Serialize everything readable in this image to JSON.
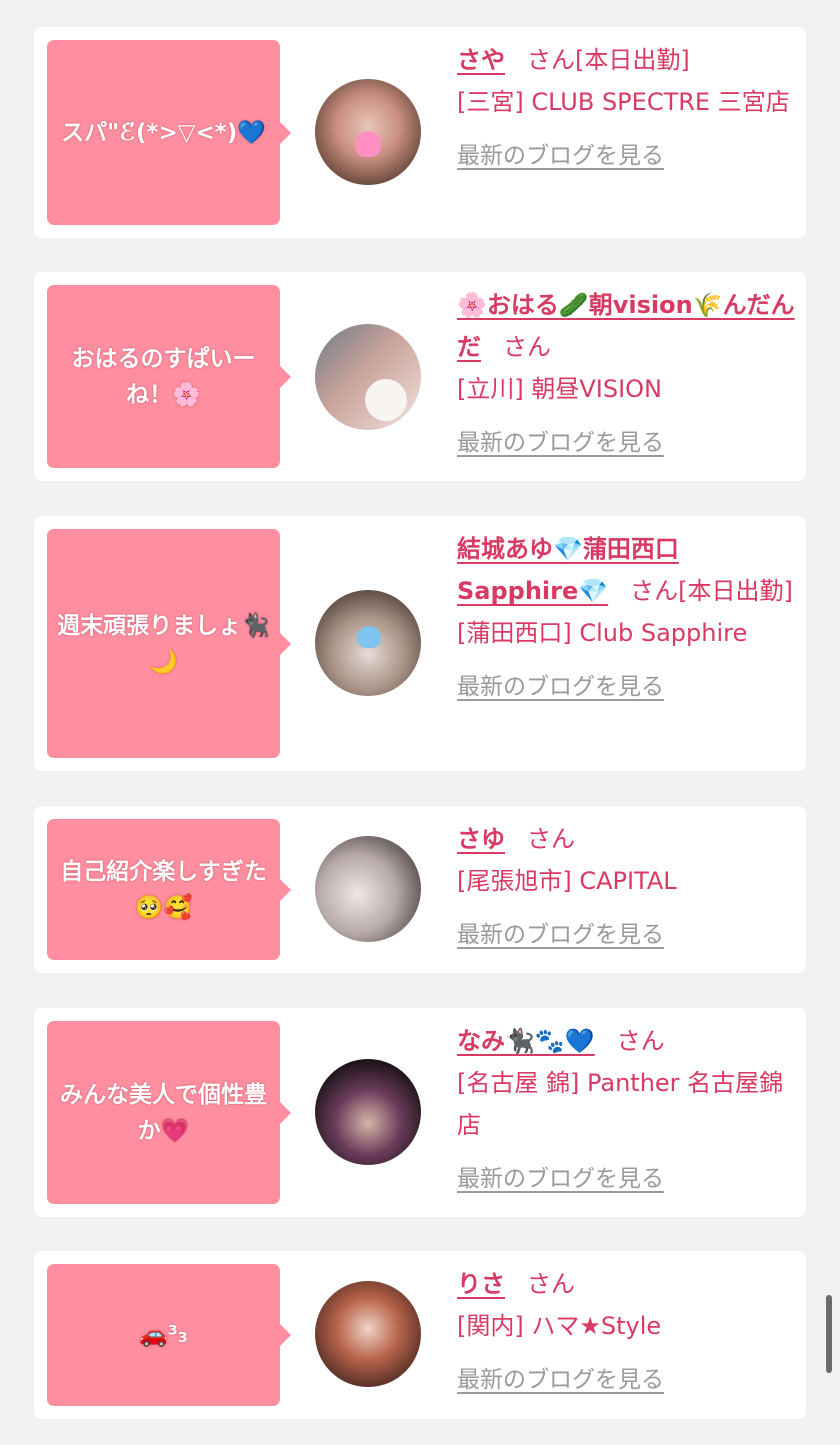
{
  "cards": [
    {
      "bubble": "スパ\"ℰ̈(*>▽<*)💙",
      "name": "さや",
      "san": "さん",
      "status": "[本日出勤]",
      "shop": "[三宮] CLUB SPECTRE 三宮店",
      "blog": "最新のブログを見る",
      "avatar_colors": [
        "#6b4a3d",
        "#e8c6b8"
      ]
    },
    {
      "bubble": "おはるのすぱいーね！🌸",
      "name": "🌸おはる🥒朝vision🌾んだんだ",
      "san": "さん",
      "status": "",
      "shop": "[立川] 朝昼VISION",
      "blog": "最新のブログを見る",
      "avatar_colors": [
        "#c9a39a",
        "#f1e4de"
      ]
    },
    {
      "bubble": "週末頑張りましょ🐈‍⬛🌙",
      "name": "結城あゆ💎蒲田西口Sapphire💎",
      "san": "さん",
      "status": "[本日出勤]",
      "shop": "[蒲田西口] Club Sapphire",
      "blog": "最新のブログを見る",
      "avatar_colors": [
        "#a79286",
        "#e6dcd6"
      ]
    },
    {
      "bubble": "自己紹介楽しすぎた🥺🥰",
      "name": "さゆ",
      "san": "さん",
      "status": "",
      "shop": "[尾張旭市] CAPITAL",
      "blog": "最新のブログを見る",
      "avatar_colors": [
        "#4a4040",
        "#efe8e6"
      ]
    },
    {
      "bubble": "みんな美人で個性豊か💗",
      "name": "なみ🐈‍⬛🐾💙",
      "san": "さん",
      "status": "",
      "shop": "[名古屋 錦] Panther 名古屋錦店",
      "blog": "最新のブログを見る",
      "avatar_colors": [
        "#1c1418",
        "#6a3b5a"
      ]
    },
    {
      "bubble": "🚗³₃",
      "name": "りさ",
      "san": "さん",
      "status": "",
      "shop": "[関内] ハマ★Style",
      "blog": "最新のブログを見る",
      "avatar_colors": [
        "#4a2a22",
        "#b8634b"
      ]
    }
  ]
}
